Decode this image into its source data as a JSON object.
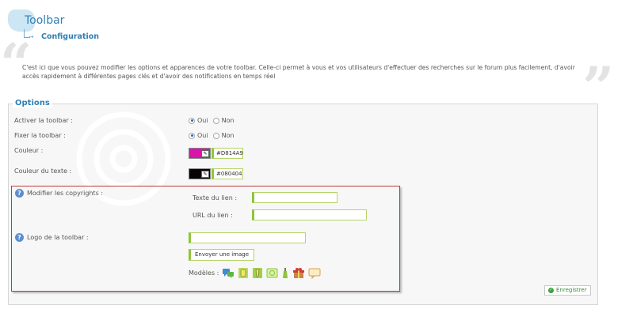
{
  "header": {
    "title": "Toolbar",
    "breadcrumb": "Configuration"
  },
  "intro": "C'est ici que vous pouvez modifier les options et apparences de votre toolbar. Celle-ci permet à vous et vos utilisateurs d'effectuer des recherches sur le forum plus facilement, d'avoir accès rapidement à différentes pages clés et d'avoir des notifications en temps réel",
  "options": {
    "legend": "Options",
    "activate": {
      "label": "Activer la toolbar :",
      "yes": "Oui",
      "no": "Non",
      "selected": "Oui"
    },
    "fix": {
      "label": "Fixer la toolbar :",
      "yes": "Oui",
      "no": "Non",
      "selected": "Oui"
    },
    "color": {
      "label": "Couleur :",
      "value": "#D814A9"
    },
    "text_color": {
      "label": "Couleur du texte :",
      "value": "#080404"
    },
    "copyrights": {
      "label": "Modifier les copyrights :",
      "link_text_label": "Texte du lien :",
      "link_url_label": "URL du lien :",
      "link_text_value": "",
      "link_url_value": ""
    },
    "logo": {
      "label": "Logo de la toolbar :",
      "value": "",
      "upload_button": "Envoyer une image",
      "models_label": "Modèles :",
      "models": [
        "chat-bubbles-icon",
        "green-jar-icon",
        "green-document-icon",
        "frame-icon",
        "bottle-icon",
        "gift-icon",
        "speech-balloon-icon"
      ]
    },
    "save_button": "Enregistrer"
  },
  "colors": {
    "accent": "#2f7fb6",
    "field_border": "#8fc43c",
    "highlight_box": "#c33a3a"
  }
}
